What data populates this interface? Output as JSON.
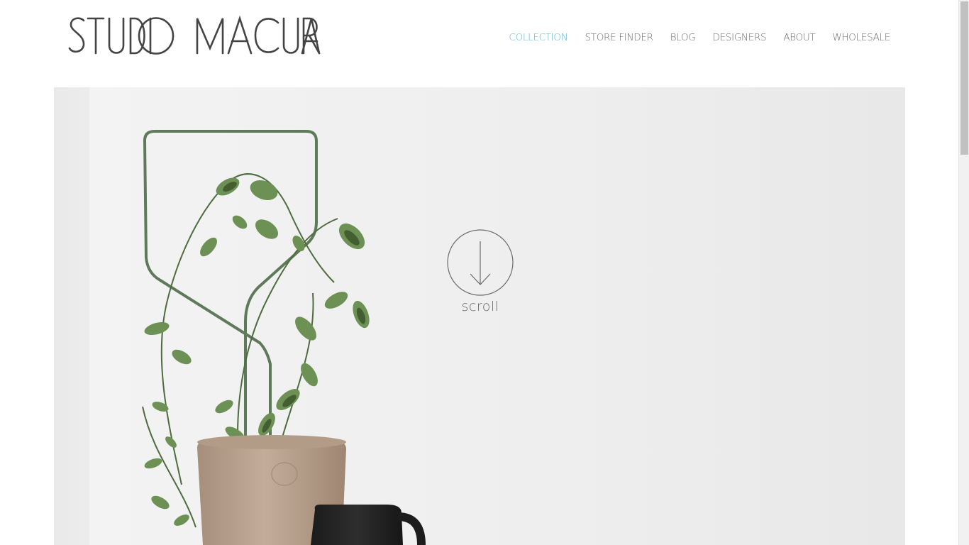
{
  "brand": {
    "logo_text": "STUDIO MACURA"
  },
  "nav": {
    "items": [
      {
        "label": "COLLECTION",
        "active": true
      },
      {
        "label": "STORE FINDER",
        "active": false
      },
      {
        "label": "BLOG",
        "active": false
      },
      {
        "label": "DESIGNERS",
        "active": false
      },
      {
        "label": "ABOUT",
        "active": false
      },
      {
        "label": "WHOLESALE",
        "active": false
      }
    ],
    "active_color": "#5bb8d8",
    "text_color": "#6b6b6b"
  },
  "hero": {
    "scroll_label": "scroll",
    "scroll_icon": "arrow-down-circle-icon"
  }
}
